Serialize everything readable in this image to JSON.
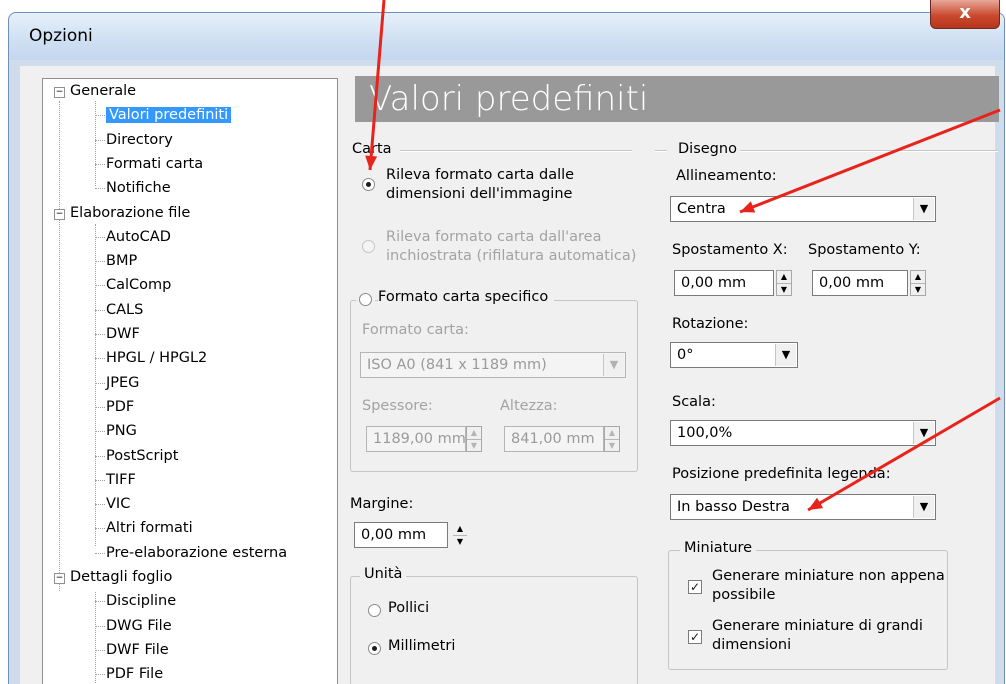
{
  "window": {
    "title": "Opzioni",
    "close_glyph": "x"
  },
  "tree": [
    {
      "label": "Generale",
      "level": 0,
      "expanded": true
    },
    {
      "label": "Valori predefiniti",
      "level": 1,
      "selected": true
    },
    {
      "label": "Directory",
      "level": 1
    },
    {
      "label": "Formati carta",
      "level": 1
    },
    {
      "label": "Notifiche",
      "level": 1
    },
    {
      "label": "Elaborazione file",
      "level": 0,
      "expanded": true
    },
    {
      "label": "AutoCAD",
      "level": 1
    },
    {
      "label": "BMP",
      "level": 1
    },
    {
      "label": "CalComp",
      "level": 1
    },
    {
      "label": "CALS",
      "level": 1
    },
    {
      "label": "DWF",
      "level": 1
    },
    {
      "label": "HPGL / HPGL2",
      "level": 1
    },
    {
      "label": "JPEG",
      "level": 1
    },
    {
      "label": "PDF",
      "level": 1
    },
    {
      "label": "PNG",
      "level": 1
    },
    {
      "label": "PostScript",
      "level": 1
    },
    {
      "label": "TIFF",
      "level": 1
    },
    {
      "label": "VIC",
      "level": 1
    },
    {
      "label": "Altri formati",
      "level": 1
    },
    {
      "label": "Pre-elaborazione esterna",
      "level": 1
    },
    {
      "label": "Dettagli foglio",
      "level": 0,
      "expanded": true
    },
    {
      "label": "Discipline",
      "level": 1
    },
    {
      "label": "DWG File",
      "level": 1
    },
    {
      "label": "DWF File",
      "level": 1
    },
    {
      "label": "PDF File",
      "level": 1
    }
  ],
  "panel": {
    "title": "Valori predefiniti",
    "carta": {
      "header": "Carta",
      "opt_image": "Rileva formato carta dalle",
      "opt_image_line2": "dimensioni dell'immagine",
      "opt_inked": "Rileva formato carta dall'area",
      "opt_inked_line2": "inchiostrata (rifilatura automatica)",
      "opt_specific": "Formato carta specifico",
      "format_label": "Formato carta:",
      "format_value": "ISO A0 (841 x 1189 mm)",
      "thickness_label": "Spessore:",
      "thickness_value": "1189,00 mm",
      "height_label": "Altezza:",
      "height_value": "841,00 mm"
    },
    "margine": {
      "label": "Margine:",
      "value": "0,00 mm"
    },
    "unita": {
      "header": "Unità",
      "opt_inches": "Pollici",
      "opt_mm": "Millimetri"
    },
    "disegno": {
      "header": "Disegno",
      "align_label": "Allineamento:",
      "align_value": "Centra",
      "offset_x_label": "Spostamento X:",
      "offset_x_value": "0,00 mm",
      "offset_y_label": "Spostamento Y:",
      "offset_y_value": "0,00 mm",
      "rotation_label": "Rotazione:",
      "rotation_value": "0°",
      "scale_label": "Scala:",
      "scale_value": "100,0%",
      "legend_label": "Posizione predefinita legenda:",
      "legend_value": "In basso Destra"
    },
    "miniature": {
      "header": "Miniature",
      "opt_asap": "Generare miniature non appena",
      "opt_asap_line2": "possibile",
      "opt_large": "Generare miniature di grandi",
      "opt_large_line2": "dimensioni"
    }
  },
  "glyphs": {
    "expander": "−",
    "dropdown": "▼",
    "spin_up": "▲",
    "spin_down": "▼",
    "check": "✓"
  },
  "colors": {
    "annotation_arrow": "#e8231c",
    "selection": "#3399ff",
    "banner": "#999999"
  }
}
